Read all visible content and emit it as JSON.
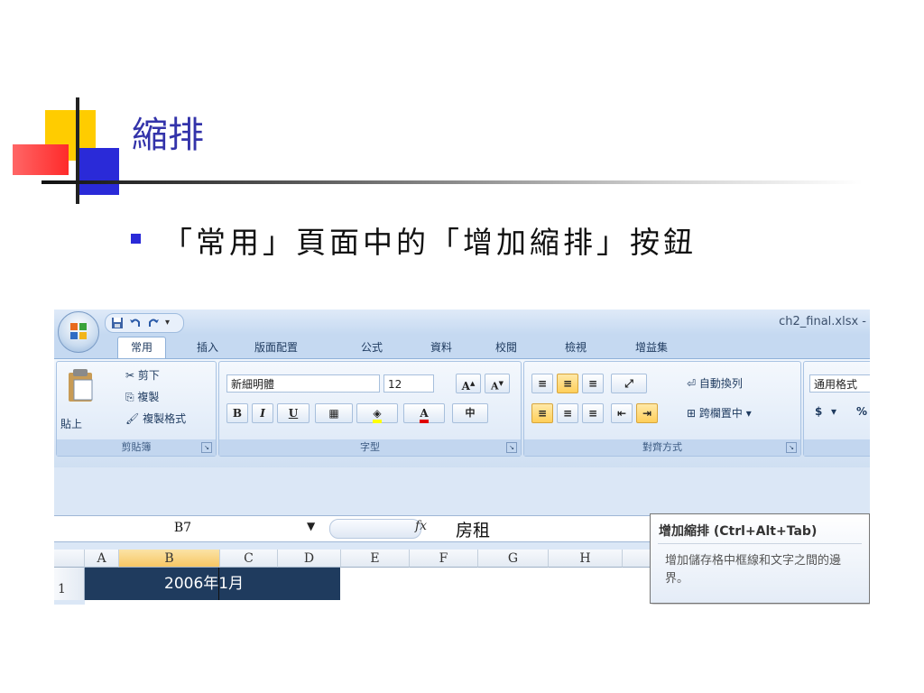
{
  "slide": {
    "title": "縮排",
    "bullet": "「常用」頁面中的「增加縮排」按鈕"
  },
  "excel": {
    "file_title": "ch2_final.xlsx -",
    "tabs": [
      "常用",
      "插入",
      "版面配置",
      "公式",
      "資料",
      "校閱",
      "檢視",
      "增益集"
    ],
    "clipboard": {
      "paste": "貼上",
      "cut": "剪下",
      "copy": "複製",
      "format_painter": "複製格式",
      "label": "剪貼簿"
    },
    "font": {
      "name": "新細明體",
      "size": "12",
      "bold": "B",
      "italic": "I",
      "underline": "U",
      "label": "字型"
    },
    "alignment": {
      "wrap_text": "自動換列",
      "merge_center": "跨欄置中",
      "label": "對齊方式"
    },
    "number": {
      "format": "通用格式",
      "currency": "$",
      "percent": "%"
    },
    "formula_bar": {
      "name_box": "B7",
      "fx": "fx",
      "value": "房租"
    },
    "columns": [
      "A",
      "B",
      "C",
      "D",
      "E",
      "F",
      "G",
      "H"
    ],
    "row_number": "1",
    "cell_b1": "2006年1月",
    "tooltip": {
      "title": "增加縮排 (Ctrl+Alt+Tab)",
      "desc": "增加儲存格中框線和文字之間的邊界。"
    }
  },
  "colors": {
    "title": "#3333aa",
    "accent_blue": "#2a2ad8",
    "accent_yellow": "#ffcc00",
    "accent_red": "#ff3333",
    "cell_fill": "#1f3b5e"
  }
}
